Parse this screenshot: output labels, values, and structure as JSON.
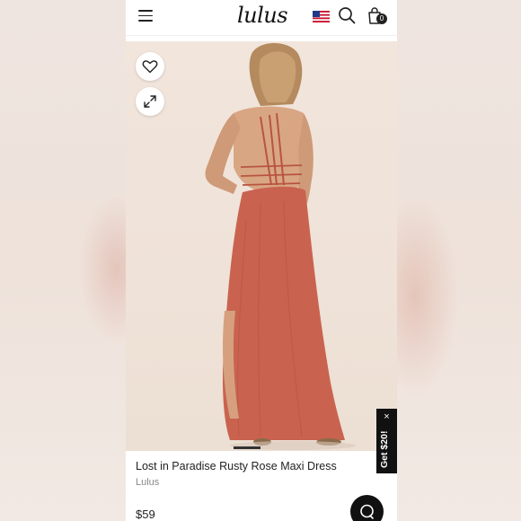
{
  "header": {
    "logo_text": "lulus",
    "cart_count": "0",
    "menu_icon": "hamburger-menu-icon",
    "flag_icon": "us-flag-icon",
    "search_icon": "search-icon",
    "bag_icon": "shopping-bag-icon"
  },
  "gallery": {
    "heart_icon": "heart-icon",
    "expand_icon": "expand-icon"
  },
  "product": {
    "title": "Lost in Paradise Rusty Rose Maxi Dress",
    "brand": "Lulus",
    "price": "$59"
  },
  "promo": {
    "label": "Get $20!",
    "close_glyph": "×"
  },
  "colors": {
    "dress": "#c9634f",
    "background": "#f0e5dc",
    "accent": "#111111"
  }
}
